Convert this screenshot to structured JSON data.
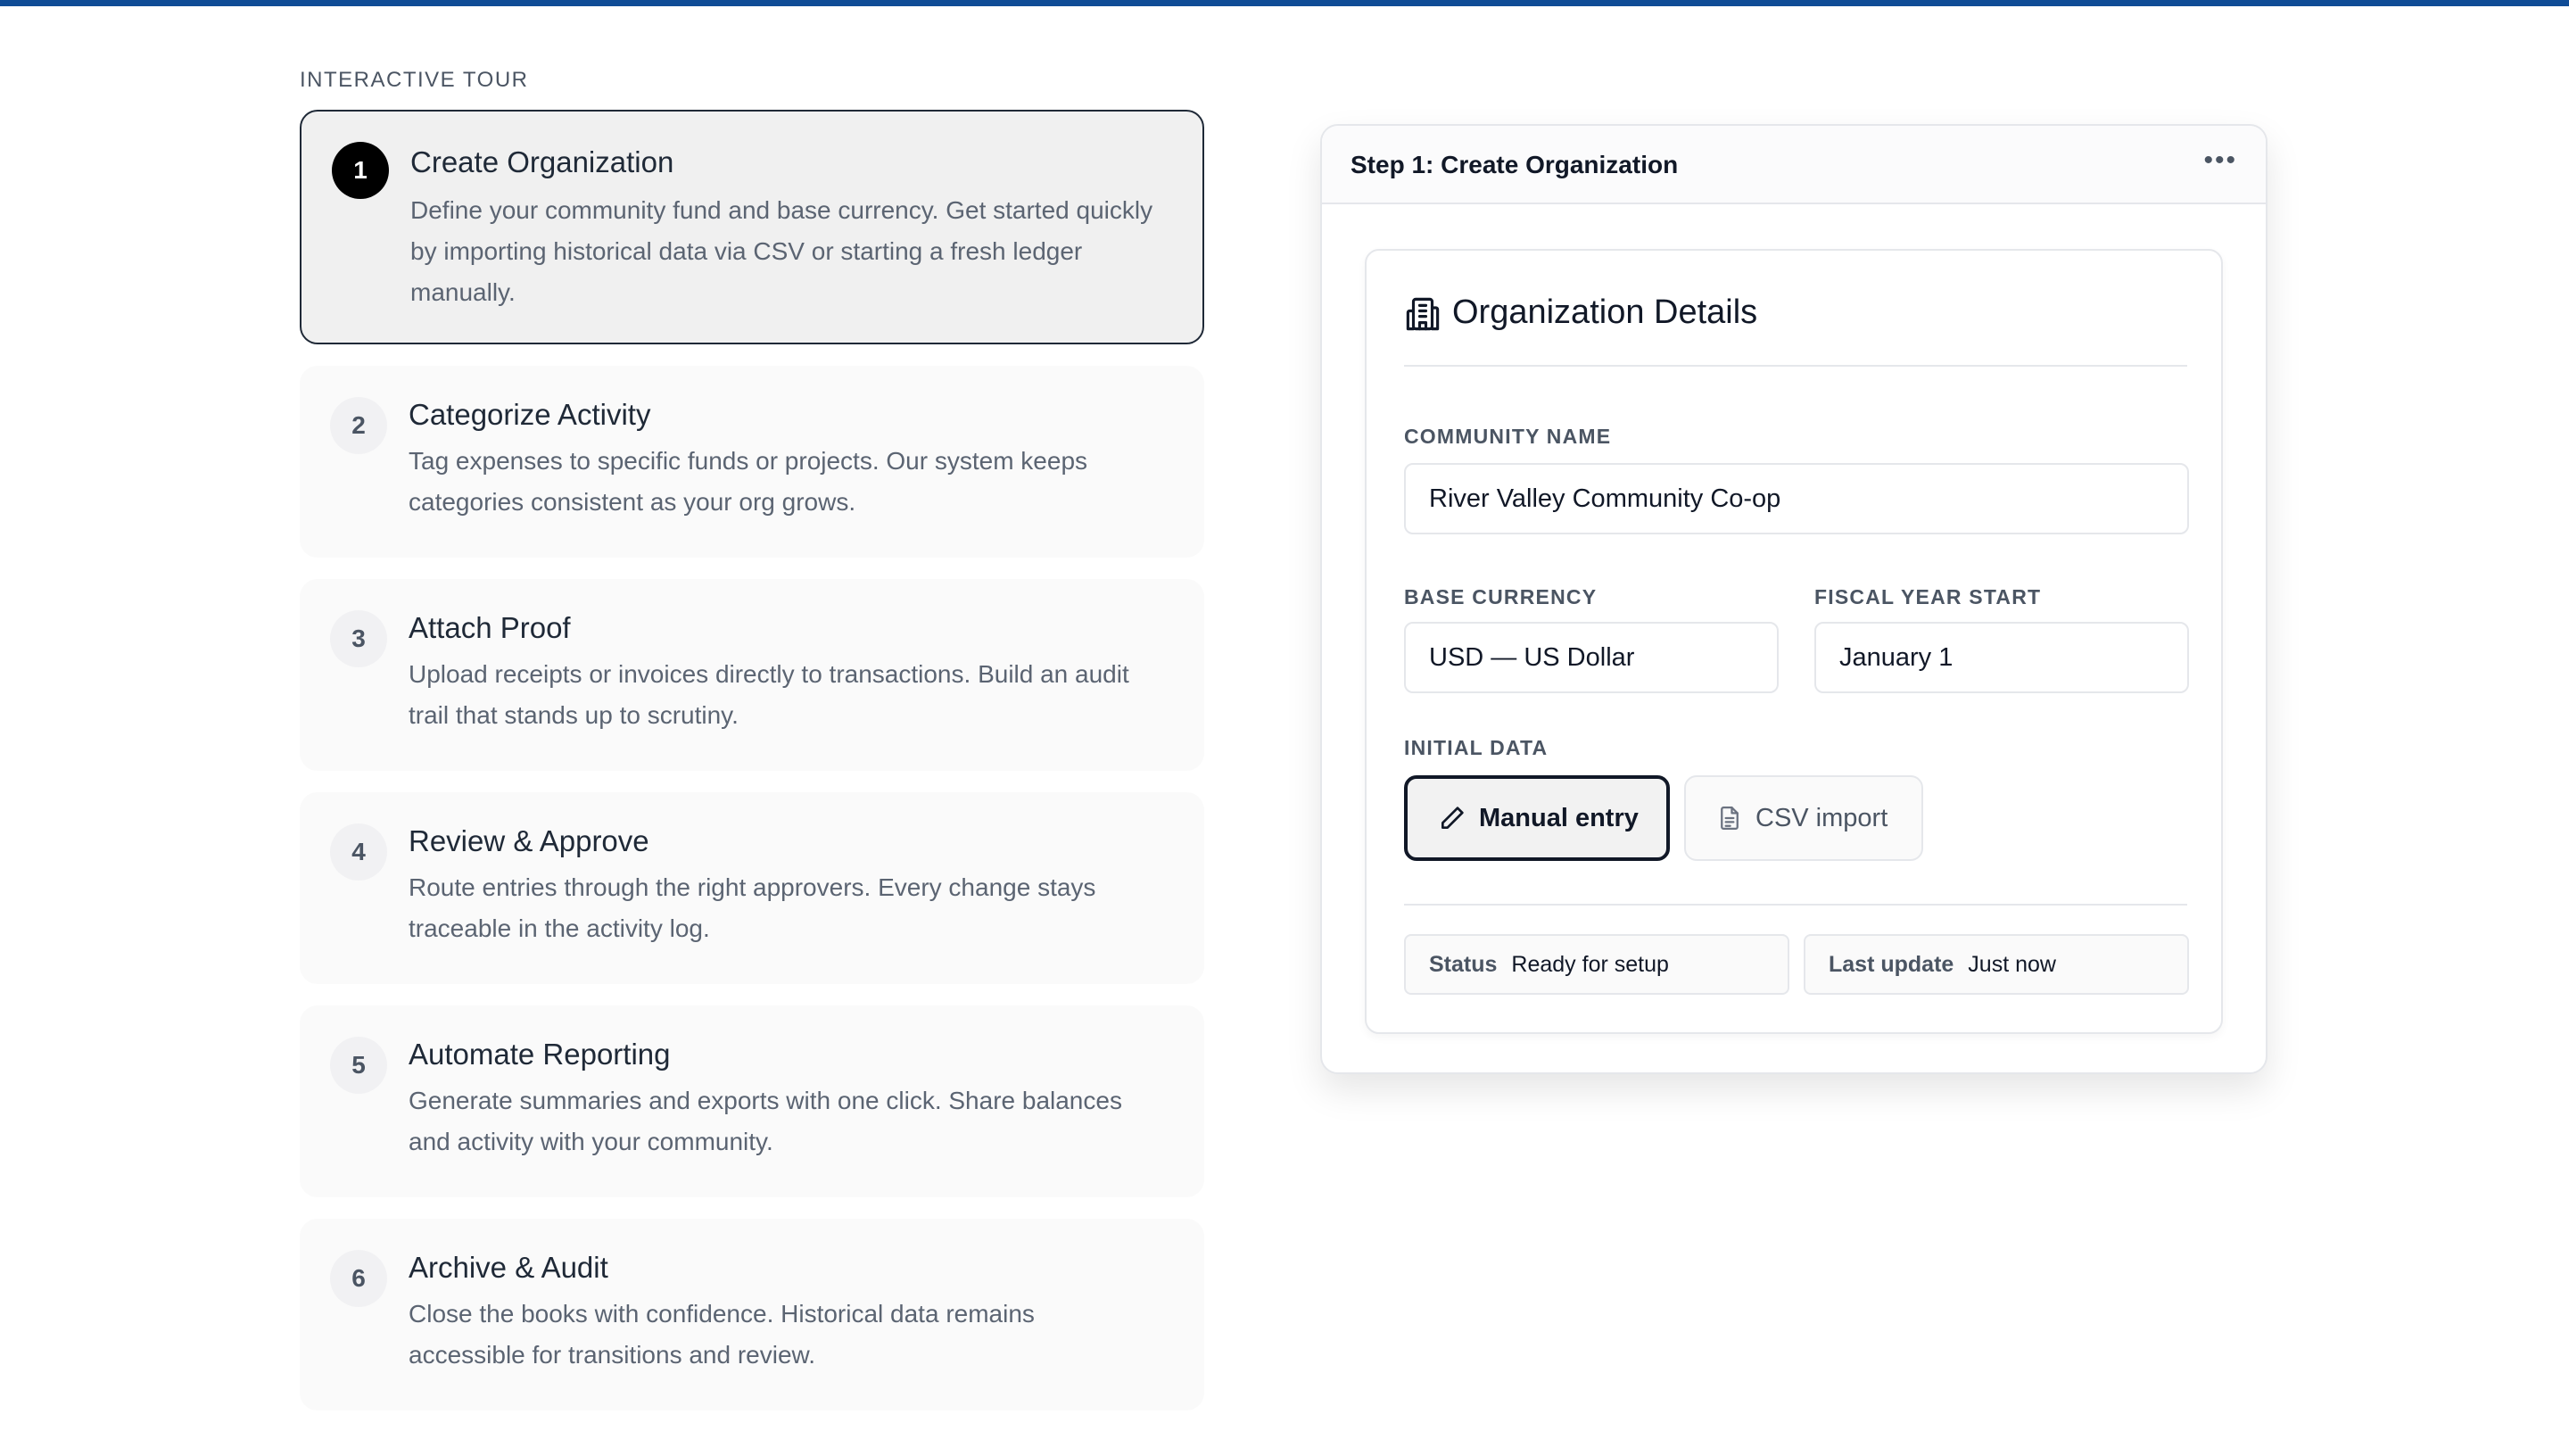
{
  "eyebrow": "INTERACTIVE TOUR",
  "steps": [
    {
      "num": "1",
      "title": "Create Organization",
      "desc": "Define your community fund and base currency. Get started quickly by importing historical data via CSV or starting a fresh ledger manually."
    },
    {
      "num": "2",
      "title": "Categorize Activity",
      "desc": "Tag expenses to specific funds or projects. Our system keeps categories consistent as your org grows."
    },
    {
      "num": "3",
      "title": "Attach Proof",
      "desc": "Upload receipts or invoices directly to transactions. Build an audit trail that stands up to scrutiny."
    },
    {
      "num": "4",
      "title": "Review & Approve",
      "desc": "Route entries through the right approvers. Every change stays traceable in the activity log."
    },
    {
      "num": "5",
      "title": "Automate Reporting",
      "desc": "Generate summaries and exports with one click. Share balances and activity with your community."
    },
    {
      "num": "6",
      "title": "Archive & Audit",
      "desc": "Close the books with confidence. Historical data remains accessible for transitions and review."
    }
  ],
  "panel": {
    "title": "Step 1: Create Organization",
    "more": "•••",
    "card": {
      "title": "Organization Details",
      "community_name_label": "COMMUNITY NAME",
      "community_name_value": "River Valley Community Co-op",
      "base_currency_label": "BASE CURRENCY",
      "base_currency_value": "USD — US Dollar",
      "fiscal_year_label": "FISCAL YEAR START",
      "fiscal_year_value": "January 1",
      "initial_data_label": "INITIAL DATA",
      "manual_entry": "Manual entry",
      "csv_import": "CSV import",
      "status_key": "Status",
      "status_value": "Ready for setup",
      "last_update_key": "Last update",
      "last_update_value": "Just now"
    }
  },
  "colors": {
    "accent": "#0f4c96",
    "active_badge": "#000000"
  }
}
